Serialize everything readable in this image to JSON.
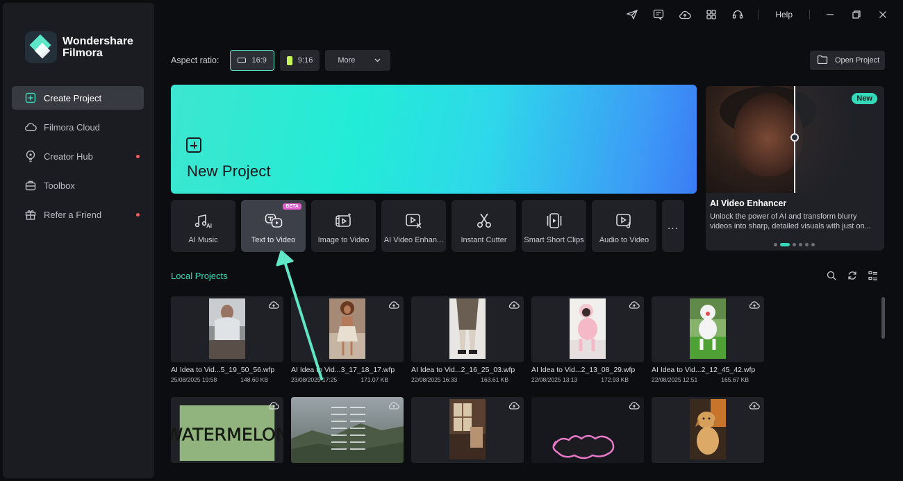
{
  "app": {
    "brand_line1": "Wondershare",
    "brand_line2": "Filmora"
  },
  "sidebar": {
    "items": [
      {
        "label": "Create Project",
        "icon": "add-square-icon",
        "active": true,
        "dot": false
      },
      {
        "label": "Filmora Cloud",
        "icon": "cloud-icon",
        "active": false,
        "dot": false
      },
      {
        "label": "Creator Hub",
        "icon": "bulb-icon",
        "active": false,
        "dot": true
      },
      {
        "label": "Toolbox",
        "icon": "toolbox-icon",
        "active": false,
        "dot": false
      },
      {
        "label": "Refer a Friend",
        "icon": "gift-icon",
        "active": false,
        "dot": true
      }
    ]
  },
  "topbar": {
    "icons": [
      "send-icon",
      "feedback-icon",
      "cloud-upload-icon",
      "grid-icon",
      "headset-icon"
    ],
    "help_label": "Help",
    "window_controls": [
      "minimize-icon",
      "restore-icon",
      "close-icon"
    ]
  },
  "aspect": {
    "label": "Aspect ratio:",
    "options": [
      {
        "label": "16:9",
        "active": true
      },
      {
        "label": "9:16",
        "active": false
      }
    ],
    "more_label": "More",
    "open_project_label": "Open Project"
  },
  "new_project": {
    "title": "New Project"
  },
  "tools": [
    {
      "label": "AI Music",
      "icon": "ai-music-icon",
      "active": false,
      "badge": ""
    },
    {
      "label": "Text to Video",
      "icon": "text-to-video-icon",
      "active": true,
      "badge": "BETA"
    },
    {
      "label": "Image to Video",
      "icon": "image-to-video-icon",
      "active": false,
      "badge": ""
    },
    {
      "label": "AI Video Enhan...",
      "icon": "ai-video-enhancer-icon",
      "active": false,
      "badge": ""
    },
    {
      "label": "Instant Cutter",
      "icon": "scissors-icon",
      "active": false,
      "badge": ""
    },
    {
      "label": "Smart Short Clips",
      "icon": "short-clips-icon",
      "active": false,
      "badge": ""
    },
    {
      "label": "Audio to Video",
      "icon": "audio-to-video-icon",
      "active": false,
      "badge": ""
    }
  ],
  "more_tools_label": "...",
  "promo": {
    "badge": "New",
    "title": "AI Video Enhancer",
    "description": "Unlock the power of AI and transform blurry videos into sharp, detailed visuals with just on...",
    "slide_count": 6,
    "active_slide": 1
  },
  "local_projects": {
    "title": "Local Projects",
    "tool_icons": [
      "search-icon",
      "refresh-icon",
      "list-view-icon"
    ],
    "row1": [
      {
        "name": "AI Idea to Vid...5_19_50_56.wfp",
        "date": "25/08/2025 19:58",
        "size": "148.60 KB",
        "thumb": "person-desk"
      },
      {
        "name": "AI Idea to Vid...3_17_18_17.wfp",
        "date": "23/08/2025 17:25",
        "size": "171.07 KB",
        "thumb": "woman-dress"
      },
      {
        "name": "AI Idea to Vid...2_16_25_03.wfp",
        "date": "22/08/2025 16:33",
        "size": "163.61 KB",
        "thumb": "person-legs"
      },
      {
        "name": "AI Idea to Vid...2_13_08_29.wfp",
        "date": "22/08/2025 13:13",
        "size": "172.93 KB",
        "thumb": "poodle-pink"
      },
      {
        "name": "AI Idea to Vid...2_12_45_42.wfp",
        "date": "22/08/2025 12:51",
        "size": "165.67 KB",
        "thumb": "poodle-grass"
      }
    ],
    "row2": [
      {
        "thumb": "watermelon-text",
        "text": "WATERMELON"
      },
      {
        "thumb": "landscape-credits"
      },
      {
        "thumb": "room-window"
      },
      {
        "thumb": "dogs-pink"
      },
      {
        "thumb": "golden-retriever"
      }
    ]
  },
  "colors": {
    "accent": "#39d7b6",
    "banner_start": "#3de6d0",
    "banner_end": "#3b7cf4",
    "beta_badge": "#e35fd0",
    "notification_dot": "#f15b5b"
  }
}
